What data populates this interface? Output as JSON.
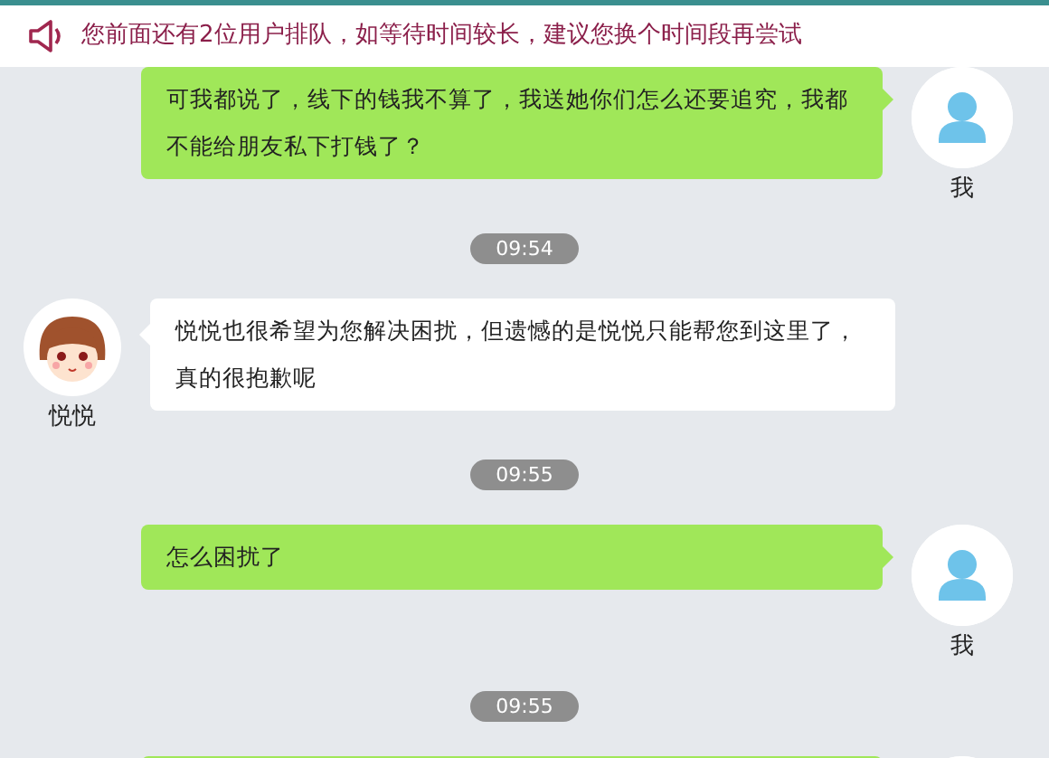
{
  "notice": {
    "text": "您前面还有2位用户排队，如等待时间较长，建议您换个时间段再尝试"
  },
  "messages": [
    {
      "kind": "me",
      "text": "可我都说了，线下的钱我不算了，我送她你们怎么还要追究，我都不能给朋友私下打钱了？",
      "sender": "我"
    },
    {
      "kind": "time",
      "text": "09:54"
    },
    {
      "kind": "other",
      "text": "悦悦也很希望为您解决困扰，但遗憾的是悦悦只能帮您到这里了，真的很抱歉呢",
      "sender": "悦悦"
    },
    {
      "kind": "time",
      "text": "09:55"
    },
    {
      "kind": "me",
      "text": "怎么困扰了",
      "sender": "我"
    },
    {
      "kind": "time",
      "text": "09:55"
    },
    {
      "kind": "me"
    }
  ]
}
